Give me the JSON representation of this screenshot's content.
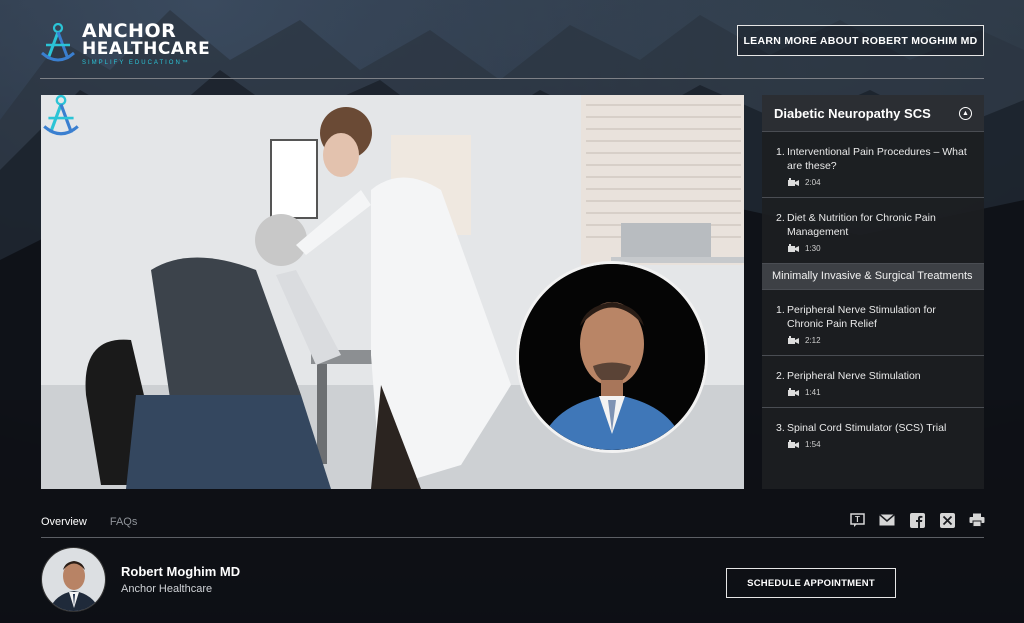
{
  "brand": {
    "name_line1": "ANCHOR",
    "name_line2": "HEALTHCARE",
    "tagline": "SIMPLIFY EDUCATION™",
    "accent_color": "#2bc4d6"
  },
  "header": {
    "learn_more_label": "LEARN MORE ABOUT ROBERT MOGHIM MD"
  },
  "playlist": {
    "title": "Diabetic Neuropathy SCS",
    "groups": [
      {
        "section": "",
        "items": [
          {
            "num": "1.",
            "title": "Interventional Pain Procedures – What are these?",
            "duration": "2:04"
          },
          {
            "num": "2.",
            "title": "Diet & Nutrition for Chronic Pain Management",
            "duration": "1:30"
          }
        ]
      },
      {
        "section": "Minimally Invasive & Surgical Treatments",
        "items": [
          {
            "num": "1.",
            "title": "Peripheral Nerve Stimulation for Chronic Pain Relief",
            "duration": "2:12"
          },
          {
            "num": "2.",
            "title": "Peripheral Nerve Stimulation",
            "duration": "1:41"
          },
          {
            "num": "3.",
            "title": "Spinal Cord Stimulator (SCS) Trial",
            "duration": "1:54"
          }
        ]
      }
    ]
  },
  "tabs": {
    "overview": "Overview",
    "faqs": "FAQs"
  },
  "share_icons": [
    "transcript-icon",
    "email-icon",
    "facebook-icon",
    "x-icon",
    "print-icon"
  ],
  "doctor": {
    "name": "Robert Moghim MD",
    "organization": "Anchor Healthcare",
    "appointment_label": "SCHEDULE APPOINTMENT"
  }
}
